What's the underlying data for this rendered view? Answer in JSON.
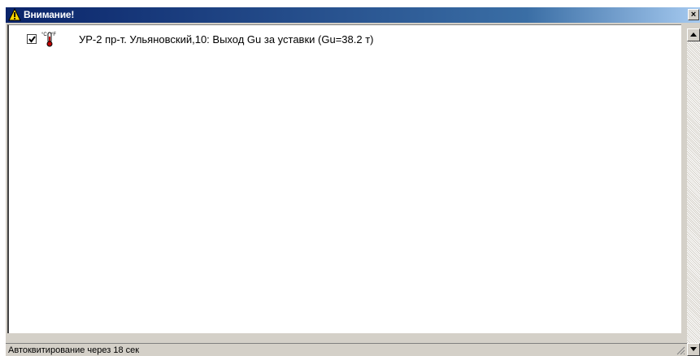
{
  "window": {
    "title": "Внимание!",
    "title_icon": "warning-icon",
    "close_label": "×"
  },
  "alarms": [
    {
      "checked": true,
      "icon": "thermometer-icon",
      "text": "УР-2 пр-т. Ульяновский,10: Выход Gu за уставки (Gu=38.2 т)"
    }
  ],
  "status": {
    "text": "Автоквитирование через 18 сек"
  },
  "colors": {
    "titlebar_start": "#0a246a",
    "titlebar_end": "#a6caf0",
    "face": "#d4d0c8"
  }
}
